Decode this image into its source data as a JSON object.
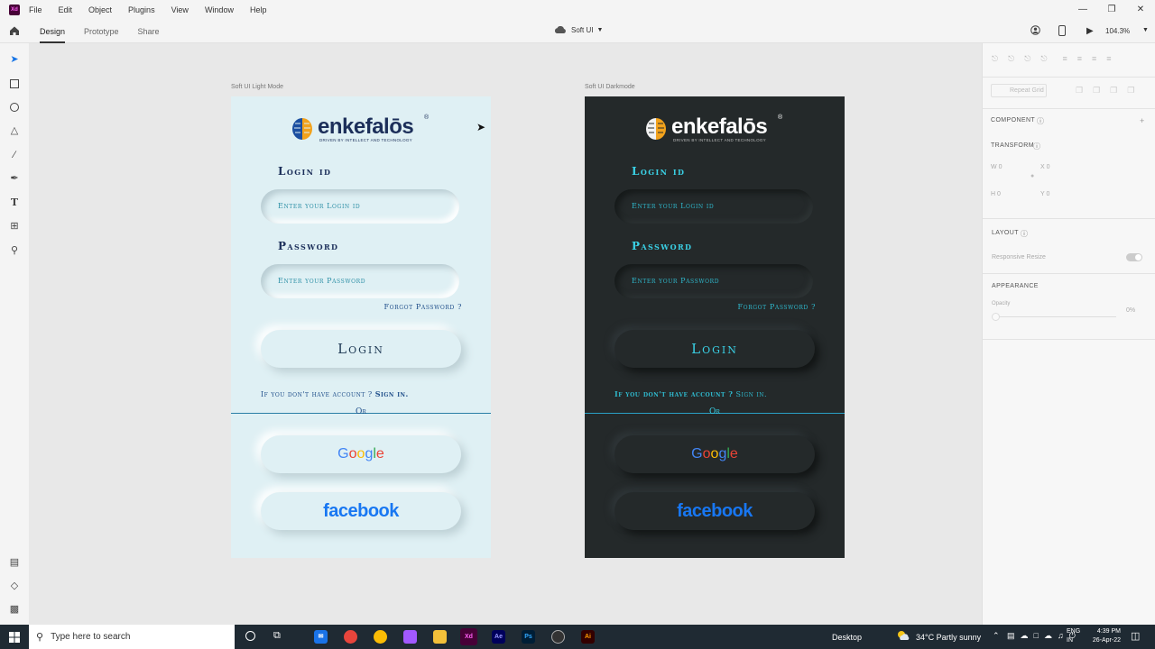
{
  "app": {
    "menu": [
      "File",
      "Edit",
      "Object",
      "Plugins",
      "View",
      "Window",
      "Help"
    ],
    "tabs": [
      "Design",
      "Prototype",
      "Share"
    ],
    "doc_title": "Soft UI",
    "zoom": "104.3%"
  },
  "artboards": {
    "light": {
      "label": "Soft UI Light Mode",
      "logo_word": "enkefalōs",
      "logo_tag": "DRIVEN BY INTELLECT AND TECHNOLOGY",
      "login_label": "Login id",
      "login_placeholder": "Enter your Login id",
      "password_label": "Password",
      "password_placeholder": "Enter your Password",
      "forgot": "Forgot Password ?",
      "login_button": "Login",
      "signin_prefix": "If you don't have account ?",
      "signin_link": "Sign in.",
      "or": "Or",
      "google": "Google",
      "facebook": "facebook"
    },
    "dark": {
      "label": "Soft UI Darkmode",
      "logo_word": "enkefalōs",
      "logo_tag": "DRIVEN BY INTELLECT AND TECHNOLOGY",
      "login_label": "Login id",
      "login_placeholder": "Enter your Login id",
      "password_label": "Password",
      "password_placeholder": "Enter your Password",
      "forgot": "Forgot Password ?",
      "login_button": "Login",
      "signin_prefix": "If you don't have account ?",
      "signin_link": "Sign in.",
      "or": "Or",
      "google": "Google",
      "facebook": "facebook"
    }
  },
  "right_panel": {
    "repeat_grid": "Repeat Grid",
    "component": "COMPONENT",
    "transform": "TRANSFORM",
    "w_label": "W",
    "w_value": "0",
    "x_label": "X",
    "x_value": "0",
    "h_label": "H",
    "h_value": "0",
    "y_label": "Y",
    "y_value": "0",
    "layout": "LAYOUT",
    "responsive": "Responsive Resize",
    "appearance": "APPEARANCE",
    "opacity": "Opacity",
    "opacity_value": "0%"
  },
  "taskbar": {
    "search_placeholder": "Type here to search",
    "desktop": "Desktop",
    "weather": "34°C  Partly sunny",
    "lang": "ENG",
    "region": "IN",
    "time": "4:39 PM",
    "date": "26-Apr-22"
  },
  "colors": {
    "light_bg": "#dff0f4",
    "dark_bg": "#24292a",
    "dark_accent": "#3ad1e6",
    "light_accent": "#1f4e8a",
    "facebook": "#1877f2"
  }
}
